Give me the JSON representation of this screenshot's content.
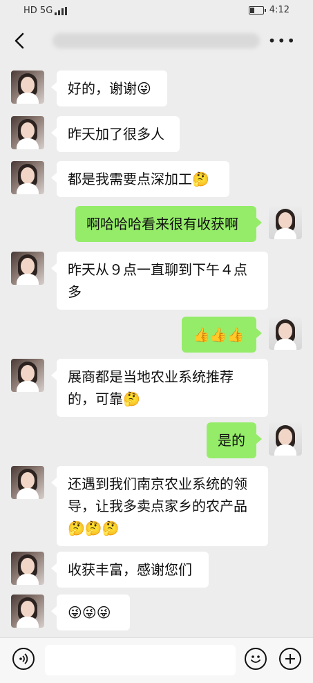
{
  "status_bar": {
    "network": "HD 5G",
    "time": "4:12"
  },
  "header": {
    "title": "",
    "back_icon": "chevron-left-icon",
    "more_icon": "ellipsis-icon"
  },
  "messages": [
    {
      "side": "left",
      "text": "好的，谢谢😜"
    },
    {
      "side": "left",
      "text": "昨天加了很多人"
    },
    {
      "side": "left",
      "text": "都是我需要点深加工🤔"
    },
    {
      "side": "right",
      "text": "啊哈哈哈看来很有收获啊"
    },
    {
      "side": "left",
      "text": "昨天从９点一直聊到下午４点多"
    },
    {
      "side": "right",
      "text": "👍👍👍"
    },
    {
      "side": "left",
      "text": "展商都是当地农业系统推荐的，可靠🤔"
    },
    {
      "side": "right",
      "text": "是的"
    },
    {
      "side": "left",
      "text": "还遇到我们南京农业系统的领导，让我多卖点家乡的农产品🤔🤔🤔"
    },
    {
      "side": "left",
      "text": "收获丰富，感谢您们"
    },
    {
      "side": "left",
      "text": "😜😜😜"
    }
  ],
  "input_bar": {
    "placeholder": "",
    "voice_icon": "voice-icon",
    "emoji_icon": "emoji-icon",
    "plus_icon": "plus-icon"
  },
  "colors": {
    "background": "#ededed",
    "incoming_bubble": "#ffffff",
    "outgoing_bubble": "#95ec69"
  }
}
